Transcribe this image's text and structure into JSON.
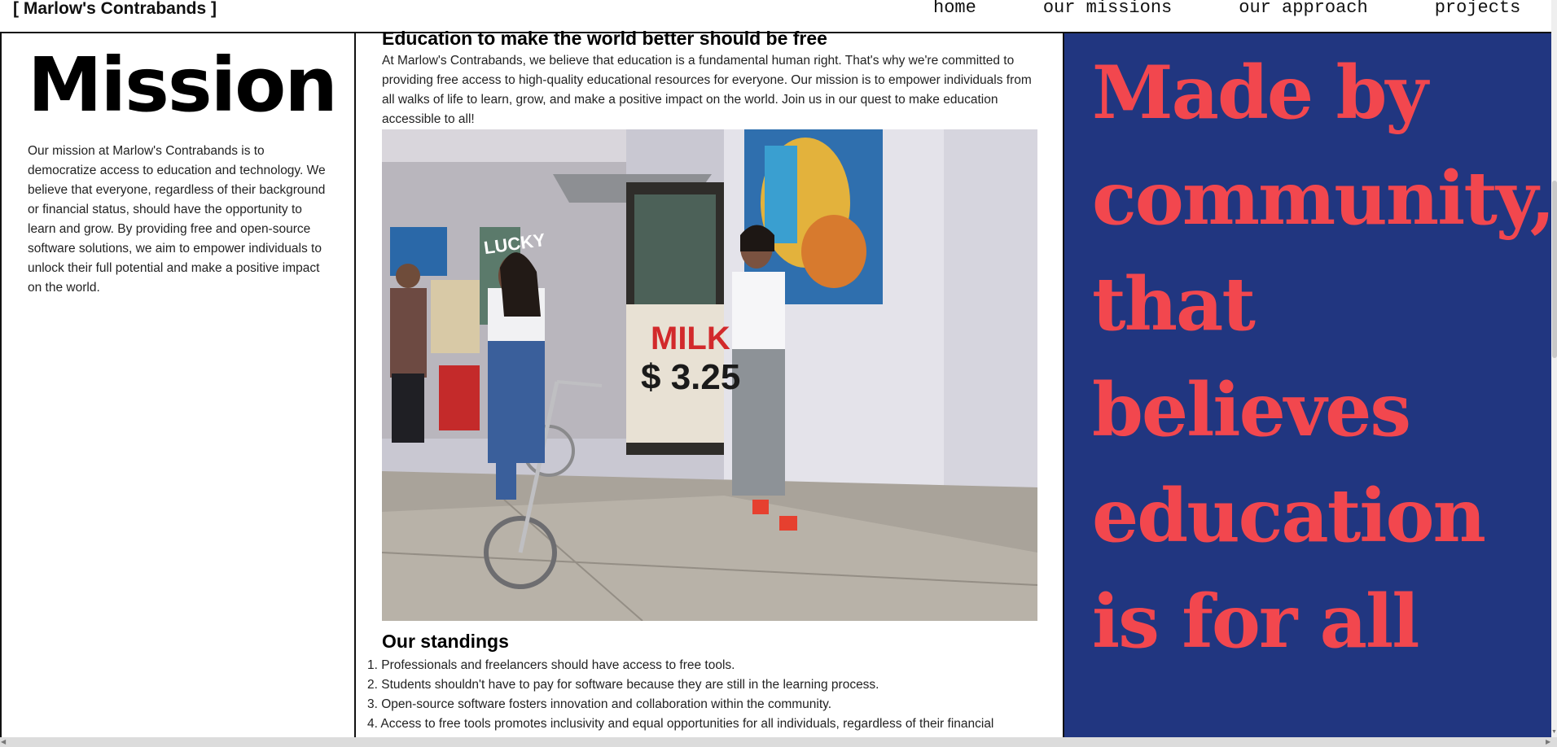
{
  "header": {
    "brand": "[ Marlow's Contrabands ]",
    "nav": [
      "home",
      "our missions",
      "our approach",
      "projects"
    ]
  },
  "left": {
    "title": "Mission",
    "text": "Our mission at Marlow's Contrabands is to democratize access to education and technology. We believe that everyone, regardless of their background or financial status, should have the opportunity to learn and grow. By providing free and open-source software solutions, we aim to empower individuals to unlock their full potential and make a positive impact on the world."
  },
  "main": {
    "heading": "Education to make the world better should be free",
    "text": "At Marlow's Contrabands, we believe that education is a fundamental human right. That's why we're committed to providing free access to high-quality educational resources for everyone. Our mission is to empower individuals from all walks of life to learn, grow, and make a positive impact on the world. Join us in our quest to make education accessible to all!",
    "photo": {
      "sign_text": "MILK",
      "price_text": "$ 3.25",
      "lucky_text": "LUCKY"
    },
    "standings_heading": "Our standings",
    "standings": [
      "1. Professionals and freelancers should have access to free tools.",
      "2. Students shouldn't have to pay for software because they are still in the learning process.",
      "3. Open-source software fosters innovation and collaboration within the community.",
      "4. Access to free tools promotes inclusivity and equal opportunities for all individuals, regardless of their financial"
    ]
  },
  "right": {
    "slogan": "Made by community, that believes education is for all",
    "colors": {
      "background": "#213680",
      "text": "#f2474e"
    }
  }
}
